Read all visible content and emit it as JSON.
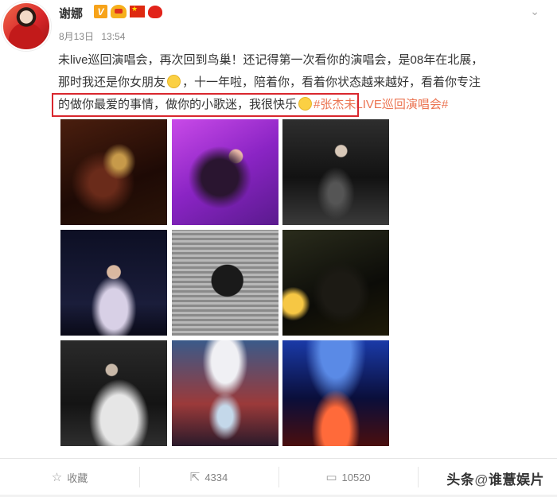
{
  "author": {
    "name": "谢娜",
    "verified_icon": "verified-v-icon",
    "badge_icons": [
      "crown-badge-icon",
      "china-flag-icon",
      "heart-badge-icon"
    ]
  },
  "meta": {
    "date": "8月13日",
    "time": "13:54"
  },
  "more_icon": "chevron-down-icon",
  "content": {
    "line1": "未live巡回演唱会，再次回到鸟巢！还记得第一次看你的演唱会，是08年在北展，",
    "line2_a": "那时我还是你女朋友",
    "line2_b": "，十一年啦，陪着你，看着你状态越来越好，看着你专注",
    "line3_a": "的做你最爱的事情，做你的小歌迷，我很快乐",
    "hashtag": "#张杰未LIVE巡回演唱会#",
    "emojis": [
      "smirk-emoji-icon",
      "smile-emoji-icon"
    ]
  },
  "photos": [
    {
      "name": "photo-1"
    },
    {
      "name": "photo-2"
    },
    {
      "name": "photo-3"
    },
    {
      "name": "photo-4"
    },
    {
      "name": "photo-5"
    },
    {
      "name": "photo-6"
    },
    {
      "name": "photo-7"
    },
    {
      "name": "photo-8"
    },
    {
      "name": "photo-9"
    }
  ],
  "actions": {
    "favorite_label": "收藏",
    "repost_count": "4334",
    "comment_count": "10520"
  },
  "watermark": {
    "source": "头条",
    "at": "@",
    "account": "谁薏娱片"
  },
  "colors": {
    "hashtag": "#eb7350",
    "highlight_border": "#d9272e",
    "muted_text": "#888888"
  }
}
